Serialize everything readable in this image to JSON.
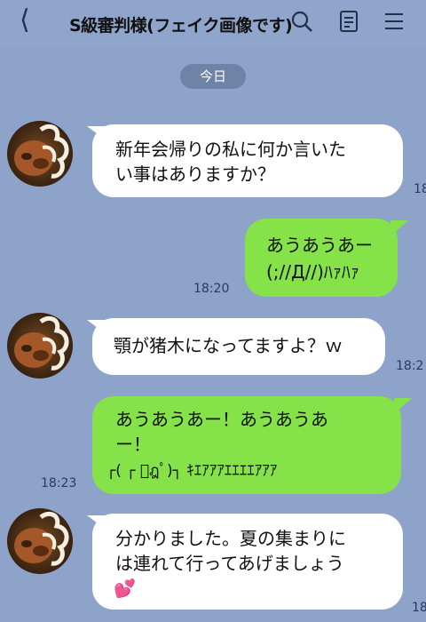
{
  "header": {
    "back_icon": "chevron-left-icon",
    "title": "S級審判様(フェイク画像です)",
    "icons": [
      "search-icon",
      "notes-icon",
      "menu-icon"
    ]
  },
  "date_label": "今日",
  "messages": [
    {
      "side": "in",
      "line1": "新年会帰りの私に何か言いた",
      "line2": "い事はありますか？",
      "time": "18:"
    },
    {
      "side": "out",
      "line1": "あうあうあー",
      "line2": "(;//Д//)ﾊｧﾊｧ",
      "time": "18:20"
    },
    {
      "side": "in",
      "line1": "顎が猪木になってますよ？ｗ",
      "time": "18:2"
    },
    {
      "side": "out",
      "line1": "あうあうあー！あうあうあ",
      "line2": "ー！",
      "line3": "┌( ┌ ﾟฎﾟ)┐ ｷｴｱｱｱｴｴｴｴｱｱｱ",
      "time": "18:23"
    },
    {
      "side": "in",
      "line1": "分かりました。夏の集まりに",
      "line2": "は連れて行ってあげましょう",
      "line3": "💕",
      "time": "18:"
    }
  ],
  "colors": {
    "background": "#8da3c9",
    "outgoing": "#85e249",
    "incoming": "#ffffff",
    "date_pill": "#6f83a6"
  }
}
